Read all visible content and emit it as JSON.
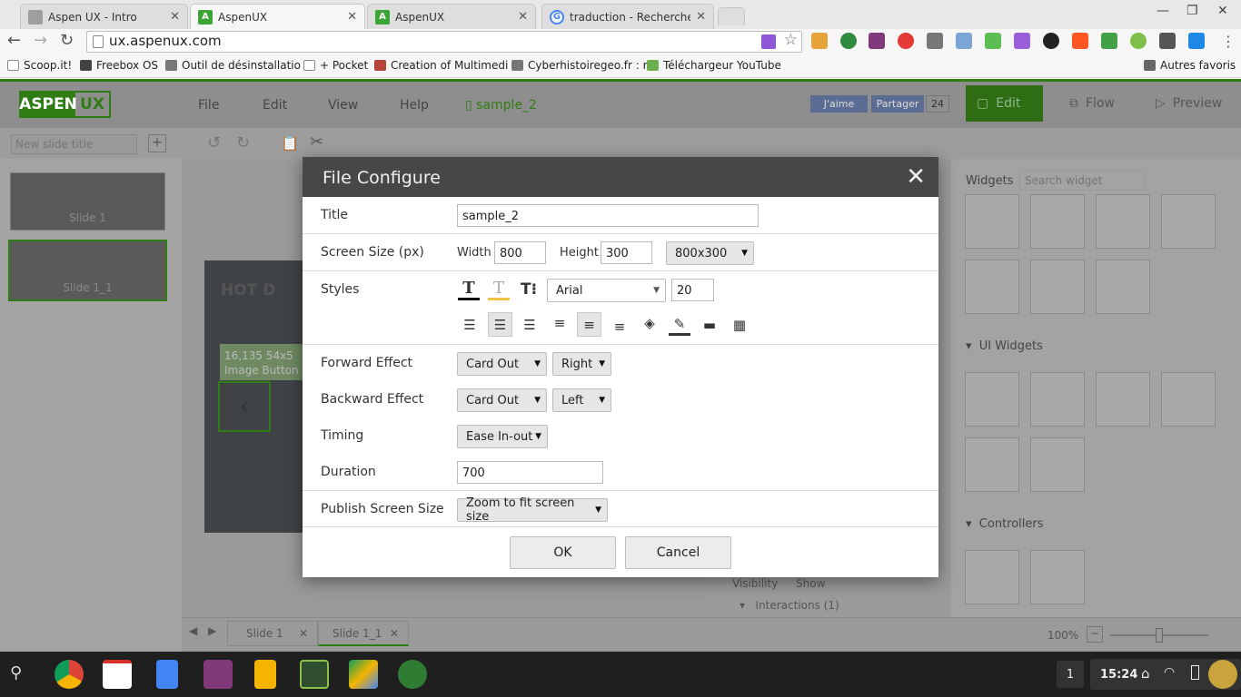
{
  "browser": {
    "tabs": [
      {
        "title": "Aspen UX - Intro",
        "fav_color": "#9e9e9e"
      },
      {
        "title": "AspenUX",
        "fav_color": "#3aa535"
      },
      {
        "title": "AspenUX",
        "fav_color": "#3aa535"
      },
      {
        "title": "traduction - Recherche Go",
        "fav_color": "#4285f4"
      }
    ],
    "url": "ux.aspenux.com",
    "bookmarks": [
      "Scoop.it!",
      "Freebox OS",
      "Outil de désinstallatio",
      "+ Pocket",
      "Creation of Multimedi",
      "Cyberhistoiregeo.fr : n",
      "Téléchargeur YouTube"
    ],
    "other_bookmarks": "Autres favoris"
  },
  "app": {
    "logo_left": "ASPEN",
    "logo_right": "UX",
    "menu": [
      "File",
      "Edit",
      "View",
      "Help"
    ],
    "filename": "sample_2",
    "like": "J'aime",
    "share": "Partager",
    "share_count": "24",
    "mode_edit": "Edit",
    "mode_flow": "Flow",
    "mode_preview": "Preview",
    "new_slide_placeholder": "New slide title",
    "slides": [
      "Slide 1",
      "Slide 1_1"
    ],
    "canvas_text_1": "HOT D",
    "canvas_coords": "16,135  54x5",
    "canvas_widget": "Image Button",
    "widgets_title": "Widgets",
    "widget_search_placeholder": "Search widget",
    "ui_widgets_title": "UI Widgets",
    "controllers_title": "Controllers",
    "visibility_label": "Visibility",
    "visibility_value": "Show",
    "interactions": "Interactions (1)",
    "zoom": "100%",
    "colors": {
      "accent": "#2f7d14",
      "header": "#474747"
    }
  },
  "dialog": {
    "title": "File Configure",
    "title_label": "Title",
    "title_value": "sample_2",
    "screen_size_label": "Screen Size (px)",
    "width_label": "Width",
    "width_value": "800",
    "height_label": "Height",
    "height_value": "300",
    "size_preset": "800x300",
    "styles_label": "Styles",
    "font": "Arial",
    "font_size": "20",
    "forward_label": "Forward Effect",
    "forward_effect": "Card Out",
    "forward_dir": "Right",
    "backward_label": "Backward Effect",
    "backward_effect": "Card Out",
    "backward_dir": "Left",
    "timing_label": "Timing",
    "timing_value": "Ease In-out",
    "duration_label": "Duration",
    "duration_value": "700",
    "publish_label": "Publish Screen Size",
    "publish_value": "Zoom to fit screen size",
    "ok": "OK",
    "cancel": "Cancel"
  },
  "taskbar": {
    "badge": "1",
    "time": "15:24"
  }
}
